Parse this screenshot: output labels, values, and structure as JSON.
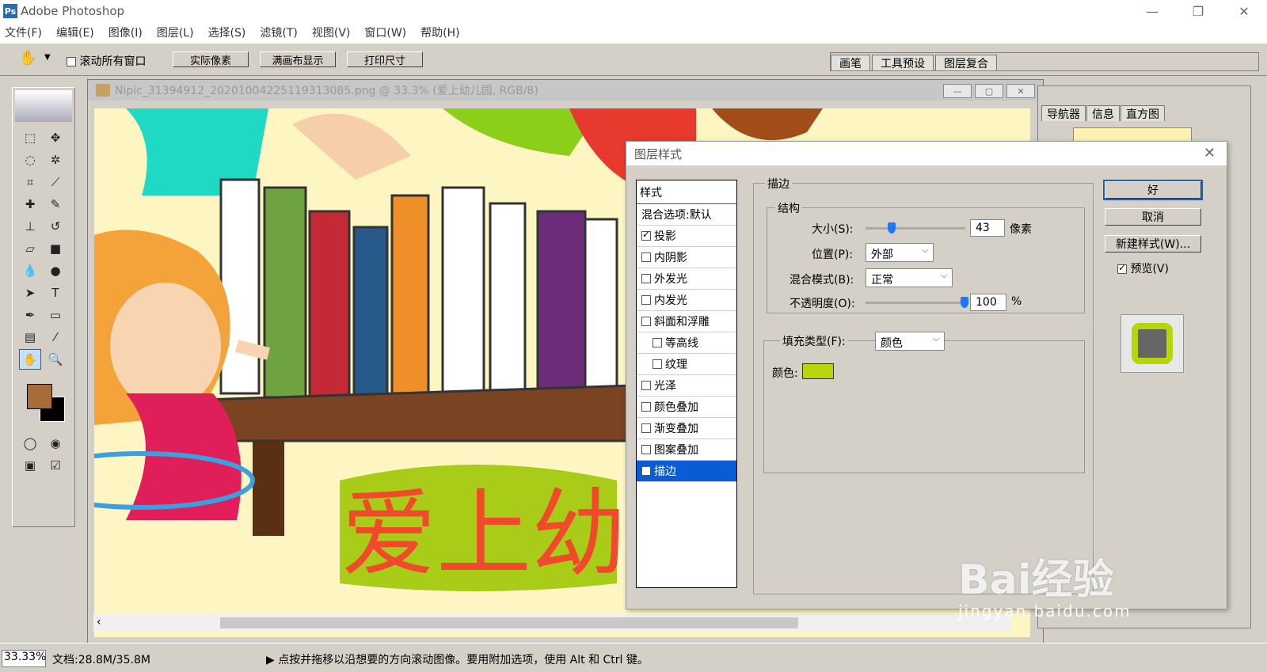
{
  "window": {
    "title": "Adobe Photoshop"
  },
  "menu": [
    "文件(F)",
    "编辑(E)",
    "图像(I)",
    "图层(L)",
    "选择(S)",
    "滤镜(T)",
    "视图(V)",
    "窗口(W)",
    "帮助(H)"
  ],
  "options": {
    "scroll_all": "滚动所有窗口",
    "actual_pixels": "实际像素",
    "fit_screen": "满画布显示",
    "print_size": "打印尺寸"
  },
  "palette_well": [
    "画笔",
    "工具预设",
    "图层复合"
  ],
  "document": {
    "title": "Nipic_31394912_20201004225119313085.png @ 33.3% (爱上幼儿园, RGB/8)",
    "canvas_text": "爱上幼"
  },
  "right_panel": {
    "tabs": [
      "导航器",
      "信息",
      "直方图"
    ]
  },
  "dialog": {
    "title": "图层样式",
    "styles_header": "样式",
    "blend_default": "混合选项:默认",
    "styles": [
      {
        "label": "投影",
        "checked": true
      },
      {
        "label": "内阴影",
        "checked": false
      },
      {
        "label": "外发光",
        "checked": false
      },
      {
        "label": "内发光",
        "checked": false
      },
      {
        "label": "斜面和浮雕",
        "checked": false
      },
      {
        "label": "等高线",
        "checked": false
      },
      {
        "label": "纹理",
        "checked": false
      },
      {
        "label": "光泽",
        "checked": false
      },
      {
        "label": "颜色叠加",
        "checked": false
      },
      {
        "label": "渐变叠加",
        "checked": false
      },
      {
        "label": "图案叠加",
        "checked": false
      },
      {
        "label": "描边",
        "checked": true
      }
    ],
    "stroke": {
      "group": "描边",
      "structure": "结构",
      "size_label": "大小(S):",
      "size_value": "43",
      "size_unit": "像素",
      "size_fraction": 0.22,
      "position_label": "位置(P):",
      "position_value": "外部",
      "blend_label": "混合模式(B):",
      "blend_value": "正常",
      "opacity_label": "不透明度(O):",
      "opacity_value": "100",
      "opacity_unit": "%",
      "fill_type_label": "填充类型(F):",
      "fill_type_value": "颜色",
      "color_label": "颜色:",
      "color_hex": "#b8d40a"
    },
    "buttons": {
      "ok": "好",
      "cancel": "取消",
      "new_style": "新建样式(W)...",
      "preview": "预览(V)"
    }
  },
  "status": {
    "zoom": "33.33%",
    "doc_size": "文档:28.8M/35.8M",
    "hint": "点按并拖移以沿想要的方向滚动图像。要用附加选项，使用 Alt 和 Ctrl 键。"
  },
  "watermark": {
    "brand": "Bai经验",
    "url": "jingyan.baidu.com"
  },
  "colors": {
    "foreground": "#a86c3a",
    "background": "#000000",
    "selection": "#0a5bd6"
  }
}
